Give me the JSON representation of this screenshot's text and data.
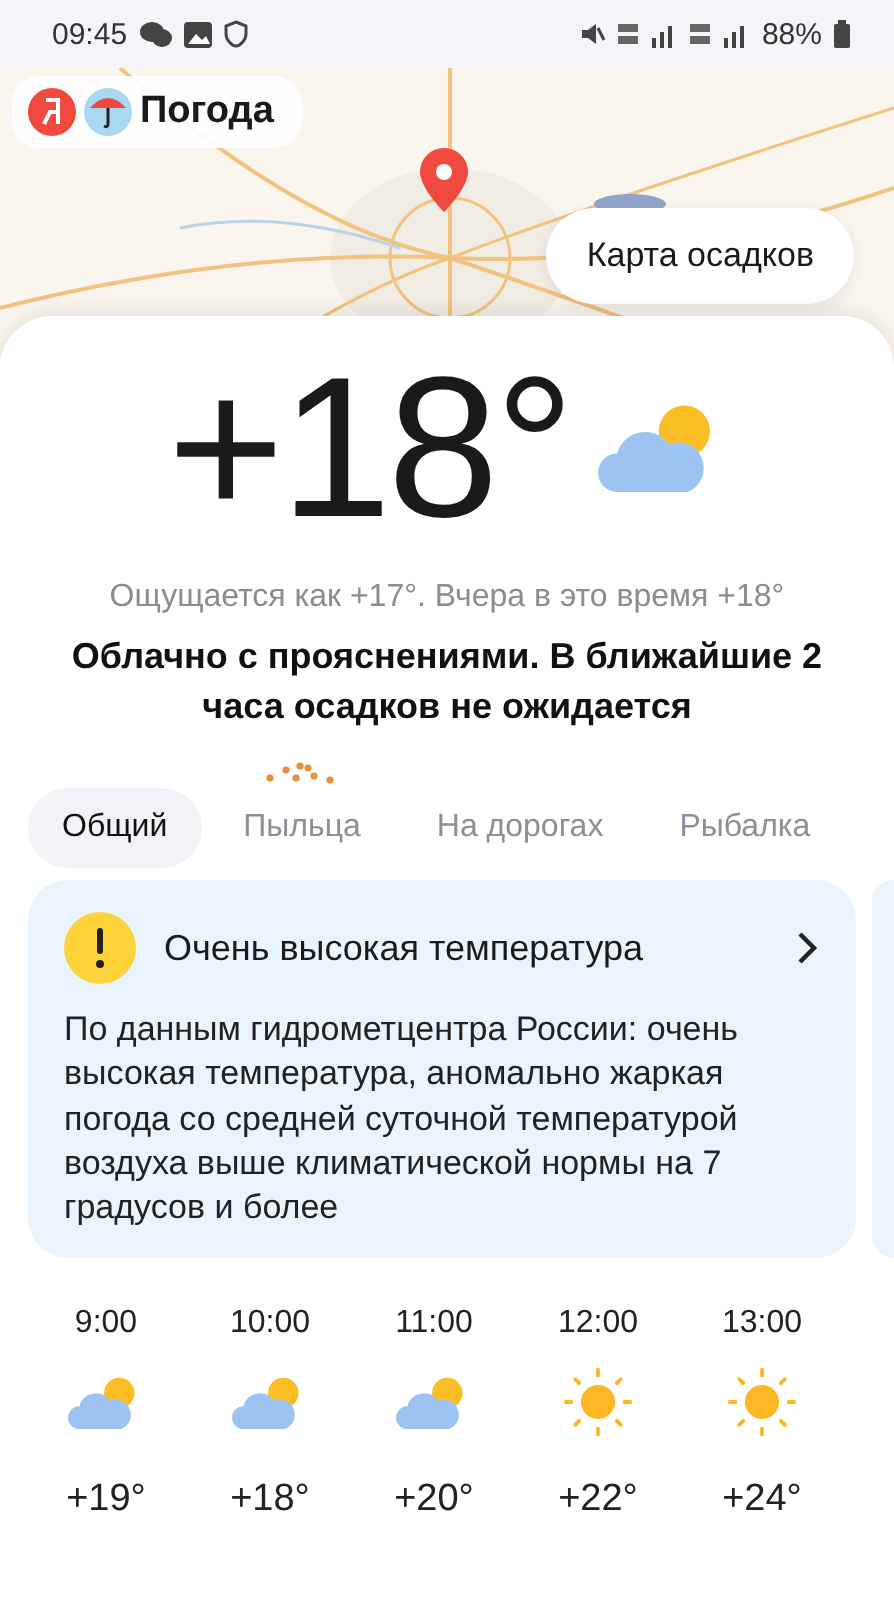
{
  "status_bar": {
    "time": "09:45",
    "battery": "88%"
  },
  "header": {
    "logo_text": "Погода",
    "map_button": "Карта осадков"
  },
  "current": {
    "temperature": "+18°",
    "kind": "partly_cloudy",
    "feels_like": "Ощущается как +17°. Вчера в это время +18°",
    "description": "Облачно с прояснениями. В ближайшие 2 часа осадков не ожидается"
  },
  "tabs": [
    {
      "label": "Общий",
      "selected": true,
      "badge": false
    },
    {
      "label": "Пыльца",
      "selected": false,
      "badge": true
    },
    {
      "label": "На дорогах",
      "selected": false,
      "badge": false
    },
    {
      "label": "Рыбалка",
      "selected": false,
      "badge": false
    }
  ],
  "alert": {
    "title": "Очень высокая температура",
    "text": "По данным гидрометцентра России: очень высокая температура, аномально жаркая погода со средней суточной температурой воздуха выше климатической нормы на 7 градусов и более"
  },
  "hourly": [
    {
      "time": "9:00",
      "kind": "partly_cloudy",
      "temperature": "+19°"
    },
    {
      "time": "10:00",
      "kind": "partly_cloudy",
      "temperature": "+18°"
    },
    {
      "time": "11:00",
      "kind": "partly_cloudy",
      "temperature": "+20°"
    },
    {
      "time": "12:00",
      "kind": "sunny",
      "temperature": "+22°"
    },
    {
      "time": "13:00",
      "kind": "sunny",
      "temperature": "+24°"
    }
  ]
}
